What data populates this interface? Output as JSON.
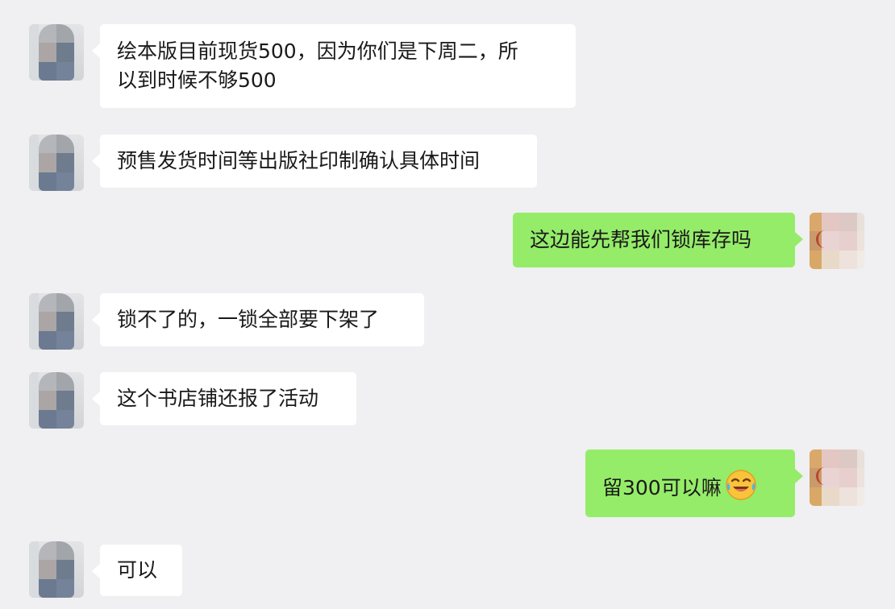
{
  "messages": [
    {
      "direction": "incoming",
      "lines": [
        "绘本版目前现货500，因为你们是下周二，所",
        "以到时候不够500"
      ]
    },
    {
      "direction": "incoming",
      "lines": [
        "预售发货时间等出版社印制确认具体时间"
      ]
    },
    {
      "direction": "outgoing",
      "lines": [
        "这边能先帮我们锁库存吗"
      ]
    },
    {
      "direction": "incoming",
      "lines": [
        "锁不了的，一锁全部要下架了"
      ]
    },
    {
      "direction": "incoming",
      "lines": [
        "这个书店铺还报了活动"
      ]
    },
    {
      "direction": "outgoing",
      "lines": [
        "留300可以嘛"
      ],
      "emoji": "laughing-crying-face-icon"
    },
    {
      "direction": "incoming",
      "lines": [
        "可以"
      ]
    }
  ],
  "colors": {
    "background": "#f0eff1",
    "incoming_bubble": "#ffffff",
    "outgoing_bubble": "#95ec69",
    "text": "#1a1a1a"
  }
}
